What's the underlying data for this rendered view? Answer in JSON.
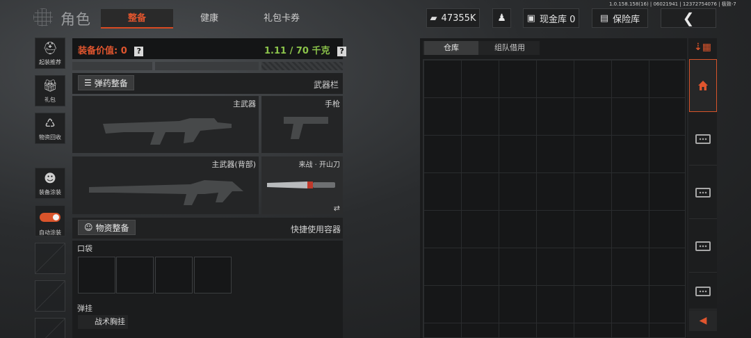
{
  "version": "1.0.158.158(16) | 06021941 | 12372754076 | 极致-7",
  "header": {
    "title": "角色",
    "tabs": [
      {
        "label": "整备",
        "active": true
      },
      {
        "label": "健康",
        "active": false
      },
      {
        "label": "礼包卡券",
        "active": false
      }
    ],
    "currency": "47355K",
    "cash_vault": "现金库 0",
    "safe": "保险库"
  },
  "sidebar": {
    "items": [
      {
        "label": "起装推荐",
        "icon": "helmet-icon"
      },
      {
        "label": "礼包",
        "icon": "gift-icon"
      },
      {
        "label": "物资回收",
        "icon": "recycle-icon"
      },
      {
        "label": "装备涂装",
        "icon": "paint-mask-icon"
      },
      {
        "label": "自动涂装",
        "icon": "toggle-icon",
        "on": true
      }
    ]
  },
  "loadout": {
    "value_label": "装备价值: 0",
    "weight": "1.11 / 70 千克",
    "ammo_button": "弹药整备",
    "weapon_bar": "武器栏",
    "primary": "主武器",
    "pistol": "手枪",
    "primary_back": "主武器(背部)",
    "melee": "来战 · 开山刀",
    "supply_button": "物资整备",
    "quick_container": "快捷使用容器",
    "pocket": "口袋",
    "rig": "弹挂",
    "rig_item": "战术胸挂"
  },
  "warehouse": {
    "tabs": [
      {
        "label": "仓库",
        "active": true
      },
      {
        "label": "组队借用",
        "active": false
      }
    ]
  },
  "colors": {
    "accent": "#d9542b",
    "weight_green": "#8bc34a"
  }
}
